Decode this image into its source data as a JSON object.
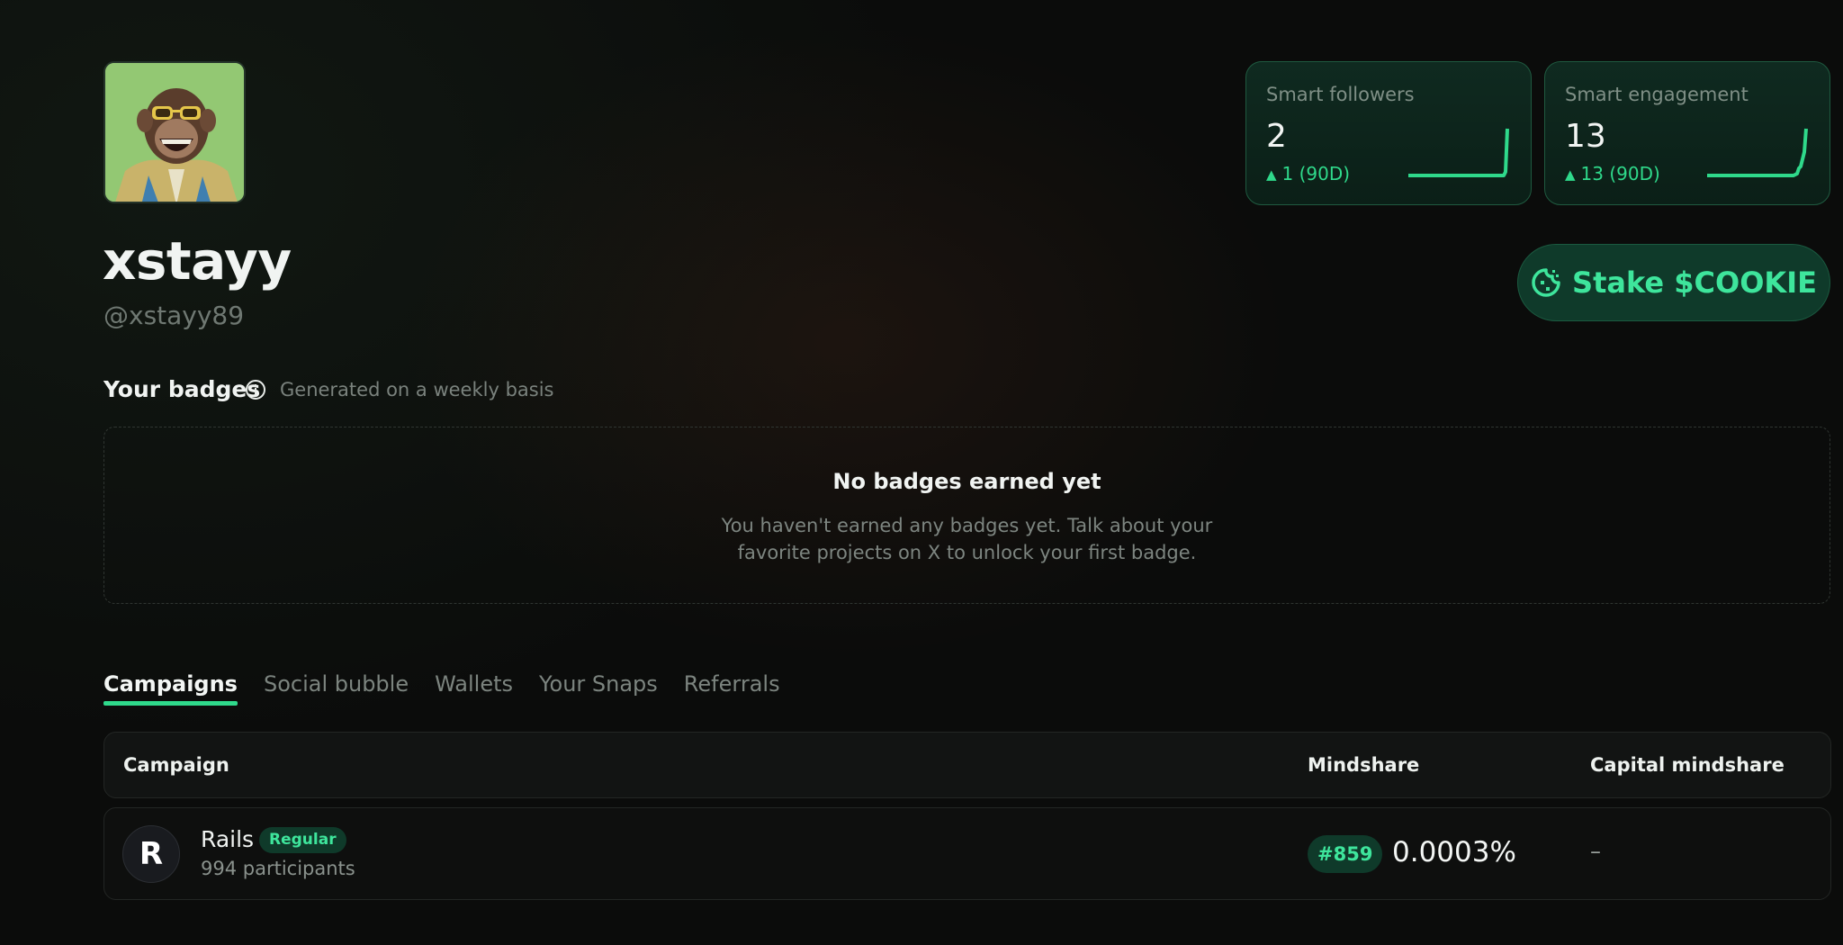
{
  "profile": {
    "display_name": "xstayy",
    "handle": "@xstayy89",
    "avatar_icon": "monkey-sunglasses-avatar"
  },
  "stats": [
    {
      "label": "Smart followers",
      "value": "2",
      "delta": "1 (90D)",
      "trend": [
        0,
        0,
        0,
        0,
        0,
        0,
        1
      ]
    },
    {
      "label": "Smart engagement",
      "value": "13",
      "delta": "13 (90D)",
      "trend": [
        0,
        0,
        0,
        0,
        0,
        1,
        13
      ]
    }
  ],
  "stake_button": {
    "label": "Stake $COOKIE",
    "icon": "cookie-icon"
  },
  "badges": {
    "title": "Your badges",
    "subtitle": "Generated on a weekly basis",
    "empty_title": "No badges earned yet",
    "empty_text_line1": "You haven't earned any badges yet. Talk about your",
    "empty_text_line2": "favorite projects on X to unlock your first badge."
  },
  "tabs": [
    {
      "label": "Campaigns",
      "active": true
    },
    {
      "label": "Social bubble",
      "active": false
    },
    {
      "label": "Wallets",
      "active": false
    },
    {
      "label": "Your Snaps",
      "active": false
    },
    {
      "label": "Referrals",
      "active": false
    }
  ],
  "table": {
    "headers": {
      "campaign": "Campaign",
      "mindshare": "Mindshare",
      "capital": "Capital mindshare"
    },
    "rows": [
      {
        "logo_letter": "R",
        "name": "Rails",
        "tag": "Regular",
        "participants": "994 participants",
        "rank": "#859",
        "mindshare": "0.0003%",
        "capital": "–"
      }
    ]
  },
  "colors": {
    "accent": "#2fd98b",
    "card_bg": "#0f2a20",
    "background": "#0b0c0b"
  }
}
